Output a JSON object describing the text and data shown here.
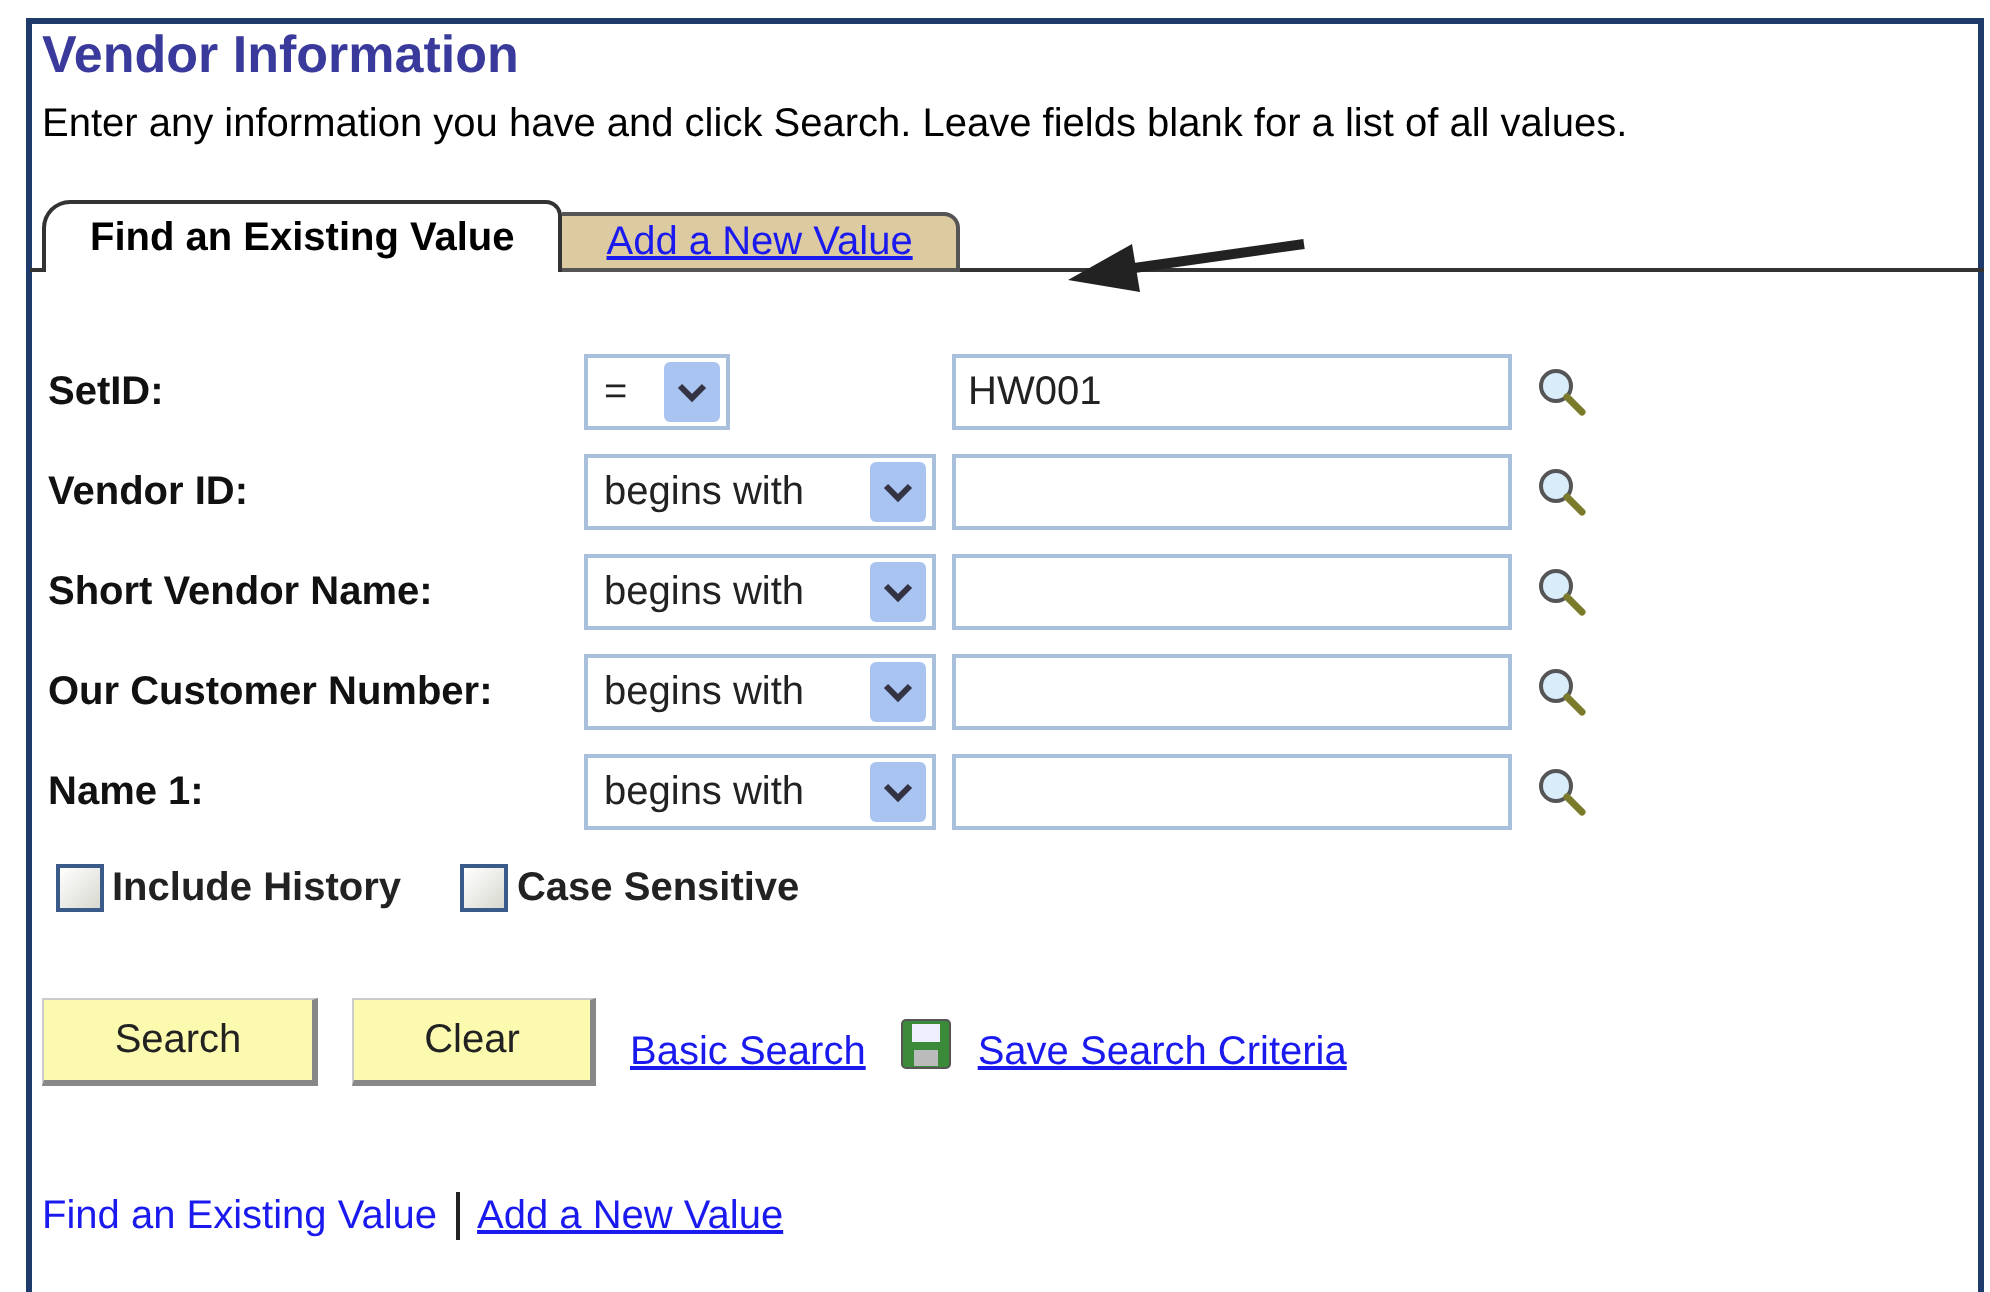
{
  "title": "Vendor Information",
  "instructions": "Enter any information you have and click Search. Leave fields blank for a list of all values.",
  "tabs": [
    {
      "label": "Find an Existing Value",
      "selected": true
    },
    {
      "label": "Add a New Value",
      "selected": false
    }
  ],
  "fields": [
    {
      "label": "SetID:",
      "operator": "=",
      "value": "HW001"
    },
    {
      "label": "Vendor ID:",
      "operator": "begins with"
    },
    {
      "label": "Short Vendor Name:",
      "operator": "begins with"
    },
    {
      "label": "Our Customer Number:",
      "operator": "begins with"
    },
    {
      "label": "Name 1:",
      "operator": "begins with"
    }
  ],
  "checkboxes": [
    {
      "label": "Include History",
      "checked": false
    },
    {
      "label": "Case Sensitive",
      "checked": false
    }
  ],
  "buttons": [
    "Search",
    "Clear"
  ],
  "links": [
    {
      "kind": "link",
      "label": "Basic Search"
    },
    {
      "kind": "save",
      "label": "Save Search Criteria"
    }
  ],
  "bottom_links": [
    {
      "label": "Find an Existing Value",
      "selected": true
    },
    {
      "label": "Add a New Value",
      "selected": false
    }
  ]
}
